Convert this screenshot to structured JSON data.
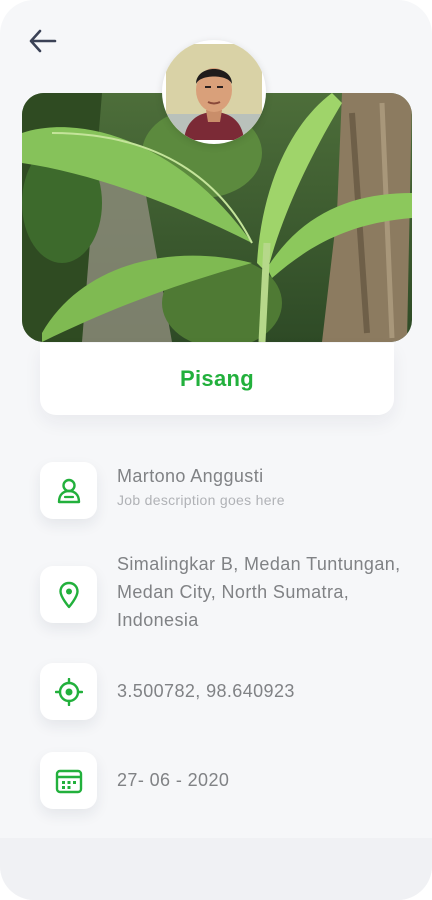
{
  "colors": {
    "accent": "#22b03c",
    "text": "#808285",
    "subtext": "#b0b2b6",
    "background": "#f6f7f9"
  },
  "nav": {
    "back_icon": "arrow-left-icon"
  },
  "plant": {
    "name": "Pisang"
  },
  "person": {
    "name": "Martono Anggusti",
    "job": "Job description goes here",
    "icon": "person-icon"
  },
  "location": {
    "address": "Simalingkar B, Medan Tuntungan, Medan City, North Sumatra, Indonesia",
    "icon": "map-pin-icon"
  },
  "coordinates": {
    "value": "3.500782, 98.640923",
    "icon": "crosshair-icon"
  },
  "date": {
    "value": "27- 06 - 2020",
    "icon": "calendar-icon"
  }
}
